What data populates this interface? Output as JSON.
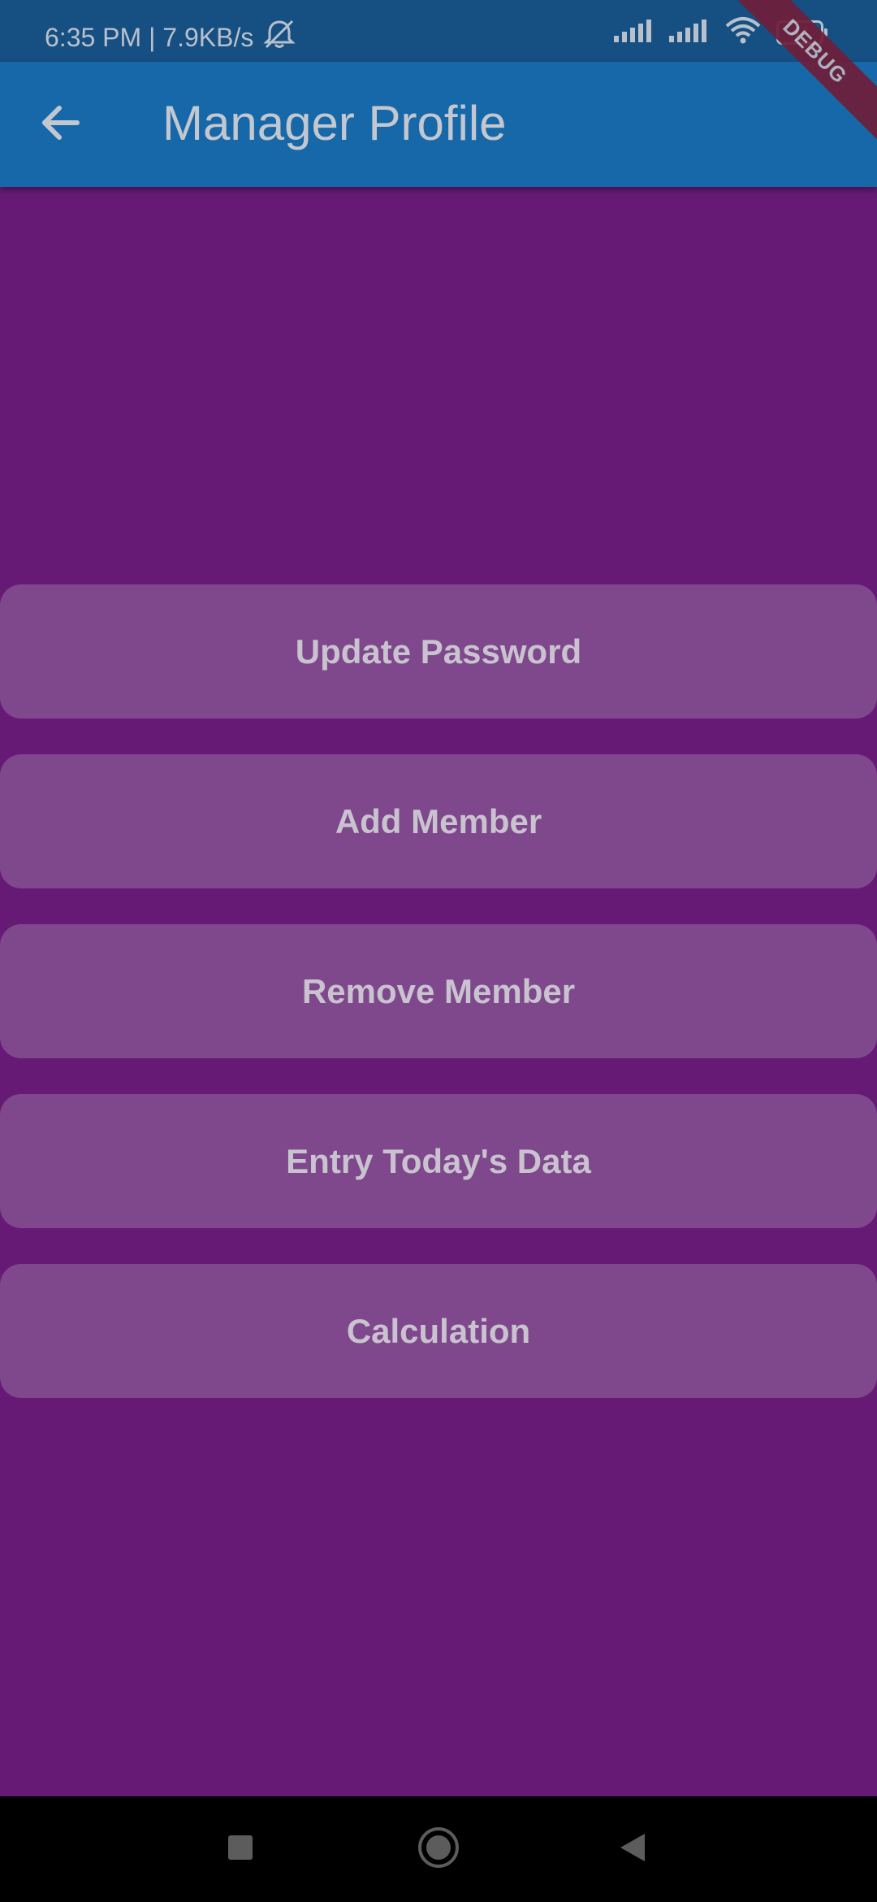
{
  "status_bar": {
    "time_speed": "6:35 PM | 7.9KB/s",
    "battery_level": "44",
    "icons": [
      "muted-alarm-icon",
      "signal-icon",
      "signal-icon",
      "wifi-icon",
      "battery-icon"
    ]
  },
  "app_bar": {
    "title": "Manager Profile",
    "back_icon": "arrow-left-icon"
  },
  "debug_banner": {
    "label": "DEBUG"
  },
  "menu": {
    "items": [
      {
        "label": "Update Password"
      },
      {
        "label": "Add Member"
      },
      {
        "label": "Remove Member"
      },
      {
        "label": "Entry Today's Data"
      },
      {
        "label": "Calculation"
      }
    ]
  },
  "nav_bar": {
    "icons": [
      "recent-apps-icon",
      "home-icon",
      "back-icon"
    ]
  },
  "colors": {
    "status_bar_bg": "#164f82",
    "app_bar_bg": "#1668a8",
    "page_bg": "#661a75",
    "button_bg": "#7f488c",
    "nav_bar_bg": "#000000"
  }
}
